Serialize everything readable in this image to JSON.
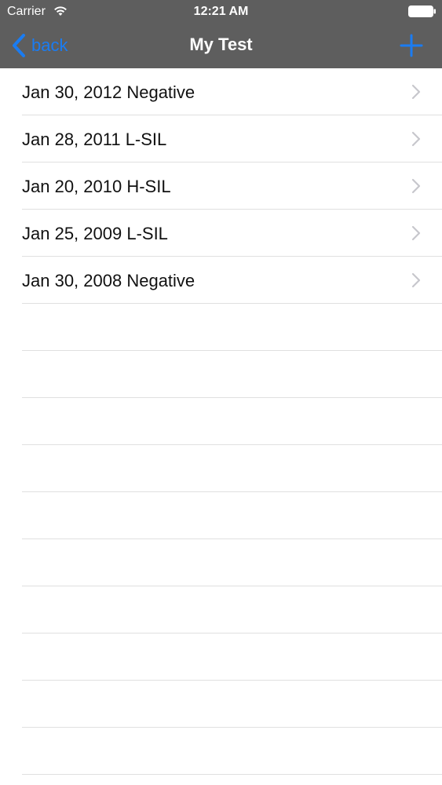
{
  "status_bar": {
    "carrier": "Carrier",
    "time": "12:21 AM"
  },
  "nav_bar": {
    "back_label": "back",
    "title": "My Test",
    "accent_color": "#1a7cf2",
    "background_color": "#5e5e5e"
  },
  "results": [
    {
      "label": "Jan 30, 2012 Negative"
    },
    {
      "label": "Jan 28, 2011 L-SIL"
    },
    {
      "label": "Jan 20, 2010 H-SIL"
    },
    {
      "label": "Jan 25, 2009 L-SIL"
    },
    {
      "label": "Jan 30, 2008 Negative"
    }
  ],
  "icons": {
    "wifi": "wifi-icon",
    "battery": "battery-icon",
    "back": "chevron-left-icon",
    "add": "plus-icon",
    "disclosure": "chevron-right-icon"
  }
}
